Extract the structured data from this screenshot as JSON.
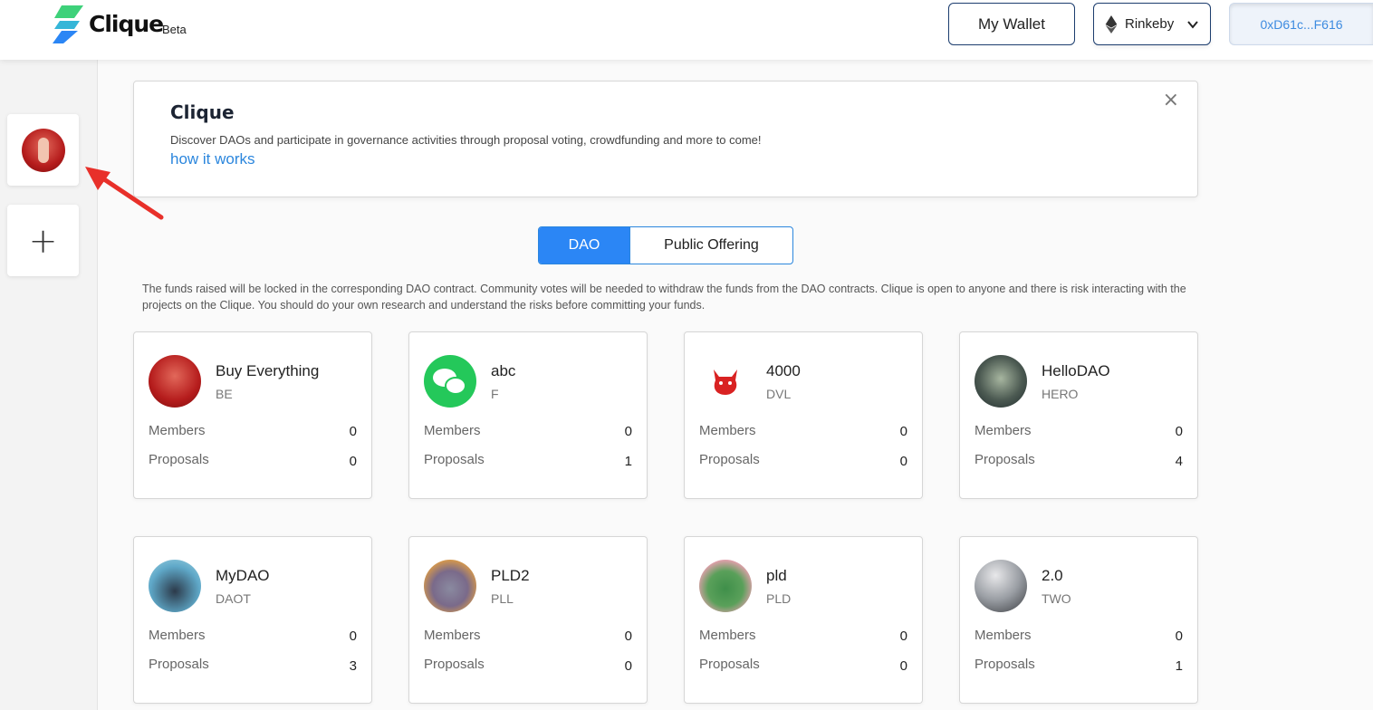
{
  "header": {
    "logo_text": "Clique",
    "logo_badge": "Beta",
    "wallet_button": "My Wallet",
    "network": "Rinkeby",
    "address": "0xD61c...F616"
  },
  "colors": {
    "accent": "#2b86f5",
    "link": "#2b86dd",
    "border_dark": "#1c3d6e"
  },
  "banner": {
    "title": "Clique",
    "description": "Discover DAOs and participate in governance activities through proposal voting, crowdfunding and more to come!",
    "link": "how it works",
    "close": "×"
  },
  "tabs": [
    "DAO",
    "Public Offering"
  ],
  "active_tab": "DAO",
  "disclaimer": "The funds raised will be locked in the corresponding DAO contract. Community votes will be needed to withdraw the funds from the DAO contracts. Clique is open to anyone and there is risk interacting with the projects on the Clique. You should do your own research and understand the risks before committing your funds.",
  "labels": {
    "members": "Members",
    "proposals": "Proposals"
  },
  "sidebar": {
    "add": "+"
  },
  "daos": [
    {
      "name": "Buy Everything",
      "symbol": "BE",
      "members": "0",
      "proposals": "0"
    },
    {
      "name": "abc",
      "symbol": "F",
      "members": "0",
      "proposals": "1"
    },
    {
      "name": "4000",
      "symbol": "DVL",
      "members": "0",
      "proposals": "0"
    },
    {
      "name": "HelloDAO",
      "symbol": "HERO",
      "members": "0",
      "proposals": "4"
    },
    {
      "name": "MyDAO",
      "symbol": "DAOT",
      "members": "0",
      "proposals": "3"
    },
    {
      "name": "PLD2",
      "symbol": "PLL",
      "members": "0",
      "proposals": "0"
    },
    {
      "name": "pld",
      "symbol": "PLD",
      "members": "0",
      "proposals": "0"
    },
    {
      "name": "2.0",
      "symbol": "TWO",
      "members": "0",
      "proposals": "1"
    }
  ]
}
